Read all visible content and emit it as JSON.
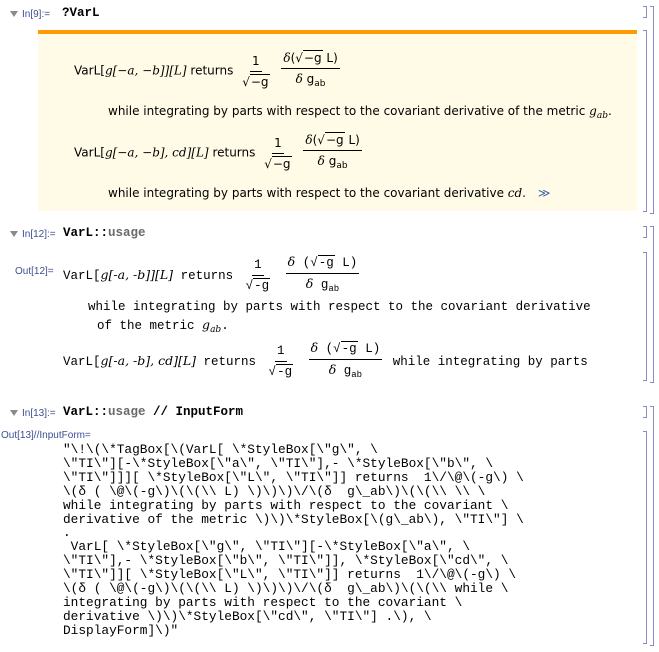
{
  "cells": [
    {
      "input_label": "In[9]:=",
      "input_prefix": "?",
      "input_code": "VarL",
      "usage_box": {
        "accent_color": "#ff9a00",
        "background_color": "#fffbe6",
        "line1_head": "VarL[",
        "line1_args": "g[−a, −b]][L]",
        "returns": "returns",
        "frac1_num": "1",
        "frac1_den": "−g",
        "frac2_num_delta": "δ",
        "frac2_num_rad": "−g",
        "frac2_num_tail": "L)",
        "frac2_den_delta": "δ",
        "frac2_den_g": "g",
        "frac2_den_sub": "ab",
        "line1_continuation": "while integrating by parts with respect to the covariant derivative of the metric",
        "line1_metric": "g",
        "line1_metric_sub": "ab",
        "line2_head": "VarL[",
        "line2_args": "g[−a, −b], cd][L]",
        "line2_continuation": "while integrating by parts with respect to the covariant derivative",
        "line2_cd": "cd.",
        "more_link": "≫"
      }
    },
    {
      "input_label": "In[12]:=",
      "input_code_a": "VarL::",
      "input_code_b": "usage",
      "output_label": "Out[12]=",
      "line1_head": "VarL[",
      "line1_args": "g[-a, -b]][L]",
      "returns": "returns",
      "frac1_num": "1",
      "frac1_den": "-g",
      "frac2_num_delta": "δ",
      "frac2_num_rad": "-g",
      "frac2_num_tail": "L)",
      "frac2_den_delta": "δ",
      "frac2_den_g": "g",
      "frac2_den_sub": "ab",
      "line1_wrap_a": "while integrating by parts with respect to the covariant derivative",
      "line1_wrap_b": "of the metric",
      "line1_metric": "g",
      "line1_metric_sub": "ab",
      "line2_head": "VarL[",
      "line2_args": "g[-a, -b], cd][L]",
      "line2_tail": "while integrating by parts"
    },
    {
      "input_label": "In[13]:=",
      "input_code_a": "VarL::",
      "input_code_b": "usage",
      "input_code_c": " // InputForm",
      "output_label": "Out[13]//InputForm=",
      "output_lines": [
        "\"\\!\\(\\*TagBox[\\(VarL[ \\*StyleBox[\\\"g\\\", \\",
        "\\\"TI\\\"][-\\*StyleBox[\\\"a\\\", \\\"TI\\\"],- \\*StyleBox[\\\"b\\\", \\",
        "\\\"TI\\\"]]][ \\*StyleBox[\\\"L\\\", \\\"TI\\\"]] returns  1\\/\\@\\(-g\\) \\",
        "\\(δ ( \\@\\(-g\\)\\(\\(\\\\ L) \\)\\)\\)\\/\\(δ  g\\_ab\\)\\(\\(\\\\ \\\\ \\",
        "while integrating by parts with respect to the covariant \\",
        "derivative of the metric \\)\\)\\*StyleBox[\\(g\\_ab\\), \\\"TI\\\"] \\",
        ".",
        " VarL[ \\*StyleBox[\\\"g\\\", \\\"TI\\\"][-\\*StyleBox[\\\"a\\\", \\",
        "\\\"TI\\\"],- \\*StyleBox[\\\"b\\\", \\\"TI\\\"]], \\*StyleBox[\\\"cd\\\", \\",
        "\\\"TI\\\"]][ \\*StyleBox[\\\"L\\\", \\\"TI\\\"]] returns  1\\/\\@\\(-g\\) \\",
        "\\(δ ( \\@\\(-g\\)\\(\\(\\\\ L) \\)\\)\\)\\/\\(δ  g\\_ab\\)\\(\\(\\\\ while \\",
        "integrating by parts with respect to the covariant \\",
        "derivative \\)\\)\\*StyleBox[\\\"cd\\\", \\\"TI\\\"] .\\), \\",
        "DisplayForm]\\)\""
      ]
    }
  ]
}
